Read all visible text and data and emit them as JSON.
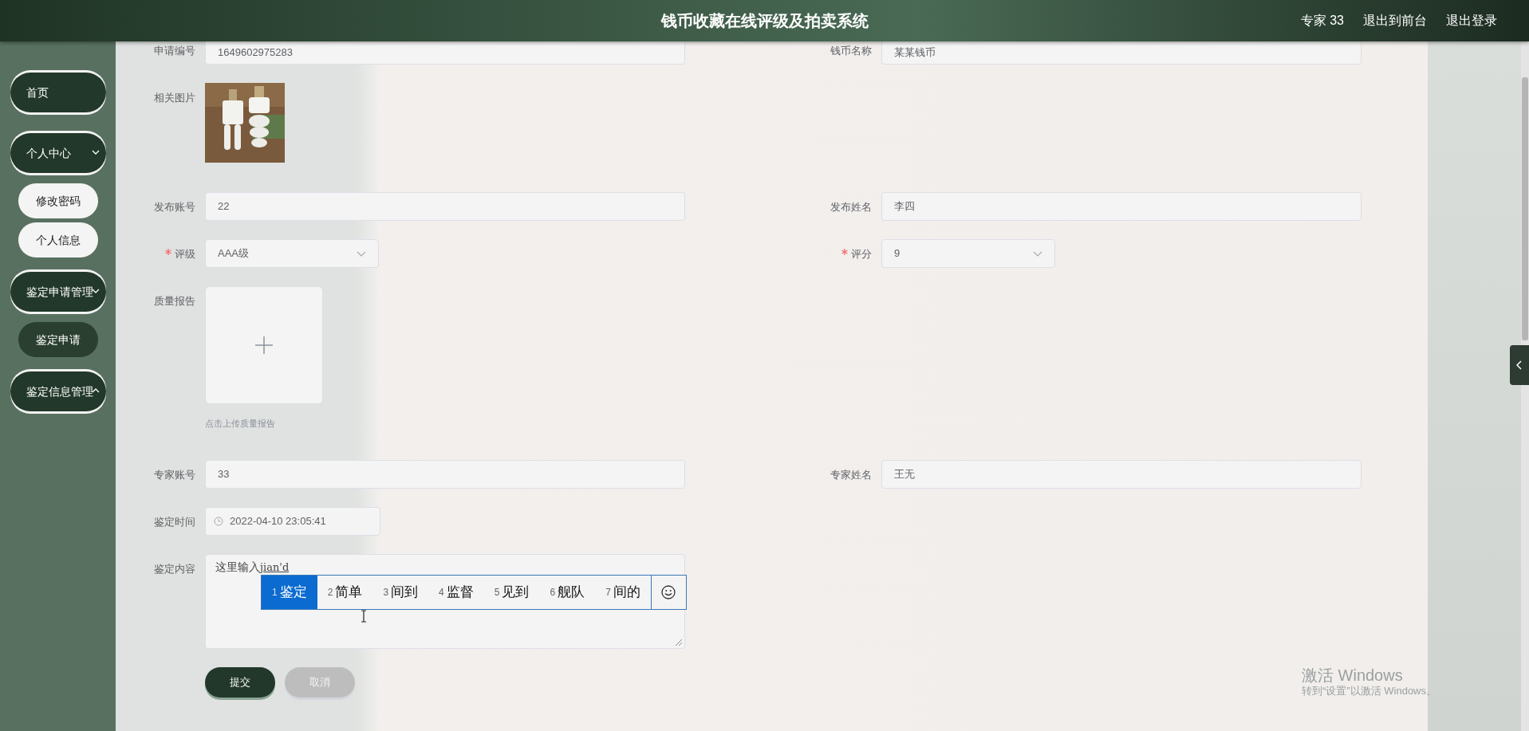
{
  "header": {
    "title": "钱币收藏在线评级及拍卖系统",
    "user": "专家 33",
    "links": [
      "退出到前台",
      "退出登录"
    ]
  },
  "sidebar": {
    "items": [
      {
        "label": "首页"
      },
      {
        "label": "个人中心",
        "expanded": true,
        "children": [
          {
            "label": "修改密码",
            "selected": false
          },
          {
            "label": "个人信息",
            "selected": false
          }
        ]
      },
      {
        "label": "鉴定申请管理",
        "expanded": true,
        "children": [
          {
            "label": "鉴定申请",
            "selected": true
          }
        ]
      },
      {
        "label": "鉴定信息管理",
        "expanded": false
      }
    ]
  },
  "form": {
    "rows": [
      {
        "fields": [
          {
            "label": "申请编号",
            "kind": "text",
            "value": "1649602975283"
          },
          {
            "label": "钱币名称",
            "kind": "text",
            "value": "某某钱币"
          }
        ]
      },
      {
        "fields": [
          {
            "label": "相关图片"
          }
        ]
      },
      {
        "fields": [
          {
            "label": "发布账号",
            "kind": "text",
            "value": "22"
          },
          {
            "label": "发布姓名",
            "kind": "text",
            "value": "李四"
          }
        ]
      },
      {
        "fields": [
          {
            "label": "评级",
            "kind": "select",
            "value": "AAA级",
            "required": true
          },
          {
            "label": "评分",
            "kind": "select",
            "value": "9",
            "required": true
          }
        ]
      },
      {
        "fields": [
          {
            "label": "质量报告",
            "kind": "upload",
            "hint": "点击上传质量报告"
          }
        ]
      },
      {
        "fields": [
          {
            "label": "专家账号",
            "kind": "text",
            "value": "33"
          },
          {
            "label": "专家姓名",
            "kind": "text",
            "value": "王无"
          }
        ]
      },
      {
        "fields": [
          {
            "label": "鉴定时间",
            "kind": "date",
            "value": "2022-04-10 23:05:41"
          }
        ]
      },
      {
        "fields": [
          {
            "label": "鉴定内容",
            "kind": "textarea",
            "value": "这里输入",
            "composition": "jian'd"
          }
        ]
      }
    ],
    "buttons": [
      {
        "label": "提交",
        "kind": "primary"
      },
      {
        "label": "取消",
        "kind": "secondary"
      }
    ]
  },
  "ime": {
    "candidates": [
      {
        "index": "1",
        "text": "鉴定",
        "selected": true
      },
      {
        "index": "2",
        "text": "简单",
        "selected": false
      },
      {
        "index": "3",
        "text": "间到",
        "selected": false
      },
      {
        "index": "4",
        "text": "监督",
        "selected": false
      },
      {
        "index": "5",
        "text": "见到",
        "selected": false
      },
      {
        "index": "6",
        "text": "舰队",
        "selected": false
      },
      {
        "index": "7",
        "text": "间的",
        "selected": false
      }
    ]
  },
  "os_notice": {
    "title": "激活 Windows",
    "subtitle": "转到“设置”以激活 Windows。"
  }
}
